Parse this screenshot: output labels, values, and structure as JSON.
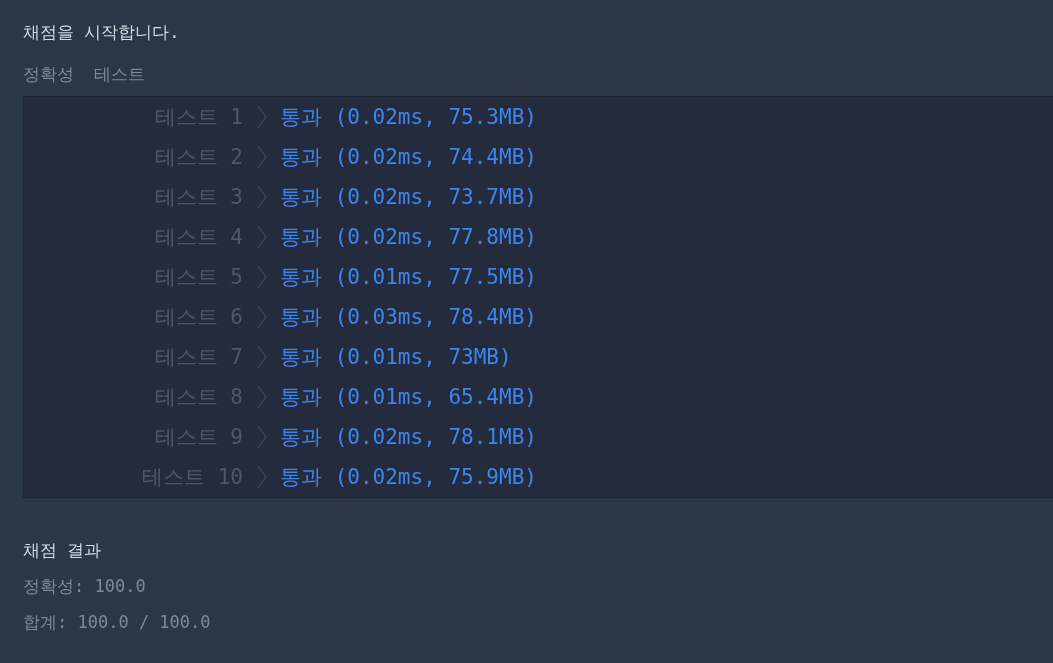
{
  "heading": "채점을 시작합니다.",
  "section_title": "정확성  테스트",
  "results": [
    {
      "label": "테스트 1",
      "result": "통과 (0.02ms, 75.3MB)"
    },
    {
      "label": "테스트 2",
      "result": "통과 (0.02ms, 74.4MB)"
    },
    {
      "label": "테스트 3",
      "result": "통과 (0.02ms, 73.7MB)"
    },
    {
      "label": "테스트 4",
      "result": "통과 (0.02ms, 77.8MB)"
    },
    {
      "label": "테스트 5",
      "result": "통과 (0.01ms, 77.5MB)"
    },
    {
      "label": "테스트 6",
      "result": "통과 (0.03ms, 78.4MB)"
    },
    {
      "label": "테스트 7",
      "result": "통과 (0.01ms, 73MB)"
    },
    {
      "label": "테스트 8",
      "result": "통과 (0.01ms, 65.4MB)"
    },
    {
      "label": "테스트 9",
      "result": "통과 (0.02ms, 78.1MB)"
    },
    {
      "label": "테스트 10",
      "result": "통과 (0.02ms, 75.9MB)"
    }
  ],
  "summary": {
    "title": "채점 결과",
    "lines": [
      "정확성: 100.0",
      "합계: 100.0 / 100.0"
    ]
  }
}
